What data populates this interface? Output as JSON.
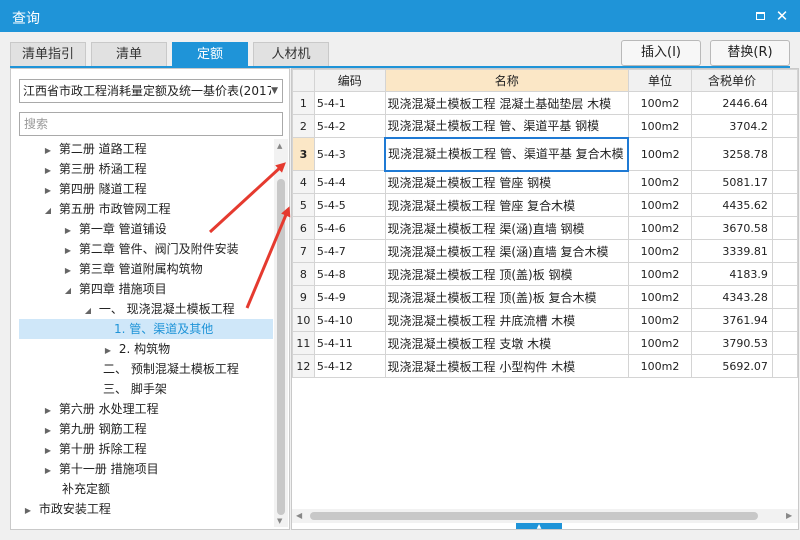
{
  "window": {
    "title": "查询"
  },
  "tabs": [
    "清单指引",
    "清单",
    "定额",
    "人材机"
  ],
  "active_tab": "定额",
  "actions": {
    "insert": "插入(I)",
    "replace": "替换(R)"
  },
  "left": {
    "dropdown_value": "江西省市政工程消耗量定额及统一基价表(2017",
    "search_placeholder": "搜索",
    "tree": [
      {
        "label": "第二册 道路工程"
      },
      {
        "label": "第三册 桥涵工程"
      },
      {
        "label": "第四册 隧道工程"
      },
      {
        "label": "第五册 市政管网工程"
      },
      {
        "label": "第一章 管道铺设"
      },
      {
        "label": "第二章 管件、阀门及附件安装"
      },
      {
        "label": "第三章 管道附属构筑物"
      },
      {
        "label": "第四章 措施项目"
      },
      {
        "label": "一、 现浇混凝土模板工程"
      },
      {
        "label": "1. 管、渠道及其他"
      },
      {
        "label": "2. 构筑物"
      },
      {
        "label": "二、 预制混凝土模板工程"
      },
      {
        "label": "三、 脚手架"
      },
      {
        "label": "第六册 水处理工程"
      },
      {
        "label": "第九册 钢筋工程"
      },
      {
        "label": "第十册 拆除工程"
      },
      {
        "label": "第十一册 措施项目"
      },
      {
        "label": "补充定额"
      },
      {
        "label": "市政安装工程"
      }
    ]
  },
  "grid": {
    "columns": [
      "编码",
      "名称",
      "单位",
      "含税单价"
    ],
    "rows": [
      {
        "n": "1",
        "code": "5-4-1",
        "name": "现浇混凝土模板工程 混凝土基础垫层 木模",
        "unit": "100m2",
        "price": "2446.64"
      },
      {
        "n": "2",
        "code": "5-4-2",
        "name": "现浇混凝土模板工程 管、渠道平基 钢模",
        "unit": "100m2",
        "price": "3704.2"
      },
      {
        "n": "3",
        "code": "5-4-3",
        "name": "现浇混凝土模板工程 管、渠道平基 复合木模",
        "unit": "100m2",
        "price": "3258.78"
      },
      {
        "n": "4",
        "code": "5-4-4",
        "name": "现浇混凝土模板工程 管座 钢模",
        "unit": "100m2",
        "price": "5081.17"
      },
      {
        "n": "5",
        "code": "5-4-5",
        "name": "现浇混凝土模板工程 管座 复合木模",
        "unit": "100m2",
        "price": "4435.62"
      },
      {
        "n": "6",
        "code": "5-4-6",
        "name": "现浇混凝土模板工程 渠(涵)直墙 钢模",
        "unit": "100m2",
        "price": "3670.58"
      },
      {
        "n": "7",
        "code": "5-4-7",
        "name": "现浇混凝土模板工程 渠(涵)直墙 复合木模",
        "unit": "100m2",
        "price": "3339.81"
      },
      {
        "n": "8",
        "code": "5-4-8",
        "name": "现浇混凝土模板工程 顶(盖)板 钢模",
        "unit": "100m2",
        "price": "4183.9"
      },
      {
        "n": "9",
        "code": "5-4-9",
        "name": "现浇混凝土模板工程 顶(盖)板 复合木模",
        "unit": "100m2",
        "price": "4343.28"
      },
      {
        "n": "10",
        "code": "5-4-10",
        "name": "现浇混凝土模板工程 井底流槽 木模",
        "unit": "100m2",
        "price": "3761.94"
      },
      {
        "n": "11",
        "code": "5-4-11",
        "name": "现浇混凝土模板工程 支墩 木模",
        "unit": "100m2",
        "price": "3790.53"
      },
      {
        "n": "12",
        "code": "5-4-12",
        "name": "现浇混凝土模板工程 小型构件 木模",
        "unit": "100m2",
        "price": "5692.07"
      }
    ]
  },
  "colors": {
    "accent": "#1f94d8",
    "header_highlight": "#fbe7c6",
    "selection": "#cfe7f9",
    "annotation_arrow": "#e53a2f"
  },
  "icons": [
    "maximize-icon",
    "close-icon",
    "expand-arrow-icon",
    "collapse-arrow-icon",
    "dropdown-arrow-icon",
    "red-arrow-annotation"
  ]
}
